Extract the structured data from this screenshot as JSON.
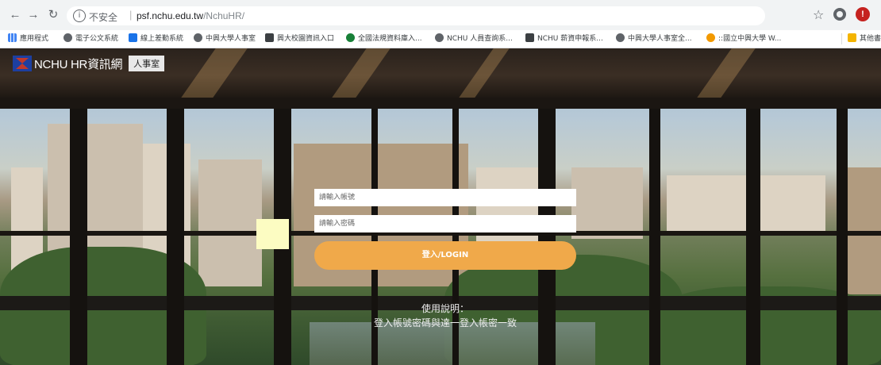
{
  "browser": {
    "security_label": "不安全",
    "host": "psf.nchu.edu.tw",
    "path": "/NchuHR/",
    "profile_initial": "!",
    "bookmarks": [
      {
        "label": "應用程式",
        "icon": "apps-icon"
      },
      {
        "label": "電子公文系統",
        "icon": "globe-icon"
      },
      {
        "label": "線上差勤系統",
        "icon": "app-icon"
      },
      {
        "label": "中興大學人事室",
        "icon": "globe-icon"
      },
      {
        "label": "興大校園資訊入口",
        "icon": "nchu-icon"
      },
      {
        "label": "全國法規資料庫入...",
        "icon": "law-icon"
      },
      {
        "label": "NCHU 人員查詢系...",
        "icon": "globe-icon"
      },
      {
        "label": "NCHU 薪資申報系...",
        "icon": "nchu-icon"
      },
      {
        "label": "中興大學人事室全...",
        "icon": "globe-icon"
      },
      {
        "label": "::國立中興大學 W...",
        "icon": "orange-icon"
      },
      {
        "label": "其他書",
        "icon": "folder-icon"
      }
    ]
  },
  "brand": {
    "name": "NCHU HR資訊網",
    "badge": "人事室"
  },
  "login": {
    "account_placeholder": "請輸入帳號",
    "password_placeholder": "請輸入密碼",
    "button_label": "登入/LOGIN"
  },
  "help": {
    "title": "使用說明：",
    "body": "登入帳號密碼與達一登入帳密一致"
  },
  "colors": {
    "login_button": "#f0a94a",
    "browser_chrome": "#f1f3f4"
  }
}
